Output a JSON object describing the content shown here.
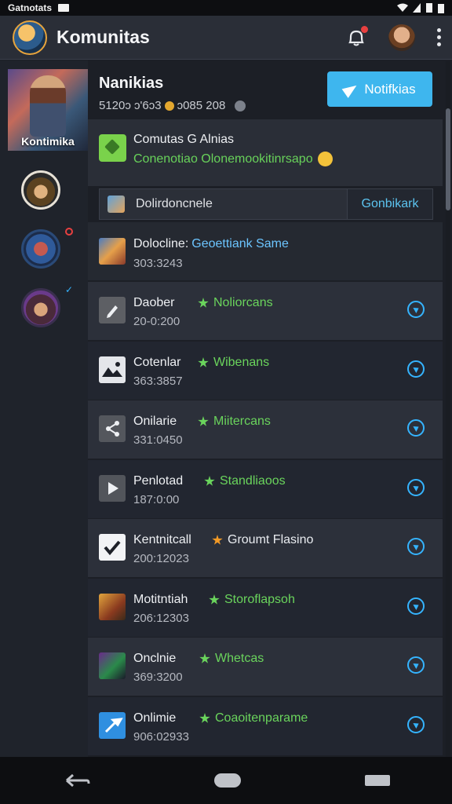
{
  "status_bar": {
    "carrier": "Gatnotats"
  },
  "app_bar": {
    "title": "Komunitas",
    "actions": [
      "notification-bell-icon",
      "user-avatar",
      "more-vertical-icon"
    ]
  },
  "sidebar": {
    "cover_label": "Kontimika"
  },
  "community": {
    "name": "Nanikias",
    "stats": "5120ɔ ɔ'6ɔ3 ",
    "stats_after": "ɔ085 208",
    "notify_button": "Notifkias"
  },
  "announcement": {
    "title": "Comutas G Alnias",
    "subtitle": "Conenotiao Olonemookitinrsapo"
  },
  "search_row": {
    "label": "Dolirdoncnele",
    "action": "Gonbikark"
  },
  "featured": {
    "title": "Dolocline:",
    "highlight": "Geoettiank Same",
    "count": "303:3243"
  },
  "items": [
    {
      "title": "Daober",
      "count": "20-0:200",
      "tag": "Noliorcans",
      "icon": "edit-icon"
    },
    {
      "title": "Cotenlar",
      "count": "363:3857",
      "tag": "Wibenans",
      "icon": "image-icon"
    },
    {
      "title": "Onilarie",
      "count": "331:0450",
      "tag": "Miitercans",
      "icon": "share-icon"
    },
    {
      "title": "Penlotad",
      "count": "187:0:00",
      "tag": "Standliaoos",
      "icon": "play-icon"
    },
    {
      "title": "Kentnitcall",
      "count": "200:12023",
      "tag": "Groumt Flasino",
      "icon": "check-icon"
    },
    {
      "title": "Motitntiah",
      "count": "206:12303",
      "tag": "Storoflapsoh",
      "icon": "hero-icon"
    },
    {
      "title": "Onclnie",
      "count": "369:3200",
      "tag": "Whetcas",
      "icon": "joker-icon"
    },
    {
      "title": "Onlimie",
      "count": "906:02933",
      "tag": "Coaoitenparame",
      "icon": "tool-icon"
    }
  ],
  "colors": {
    "accent_blue": "#3eb6ee",
    "tag_green": "#6ad45c",
    "tag_orange": "#f39a26",
    "background": "#1c1f26"
  }
}
